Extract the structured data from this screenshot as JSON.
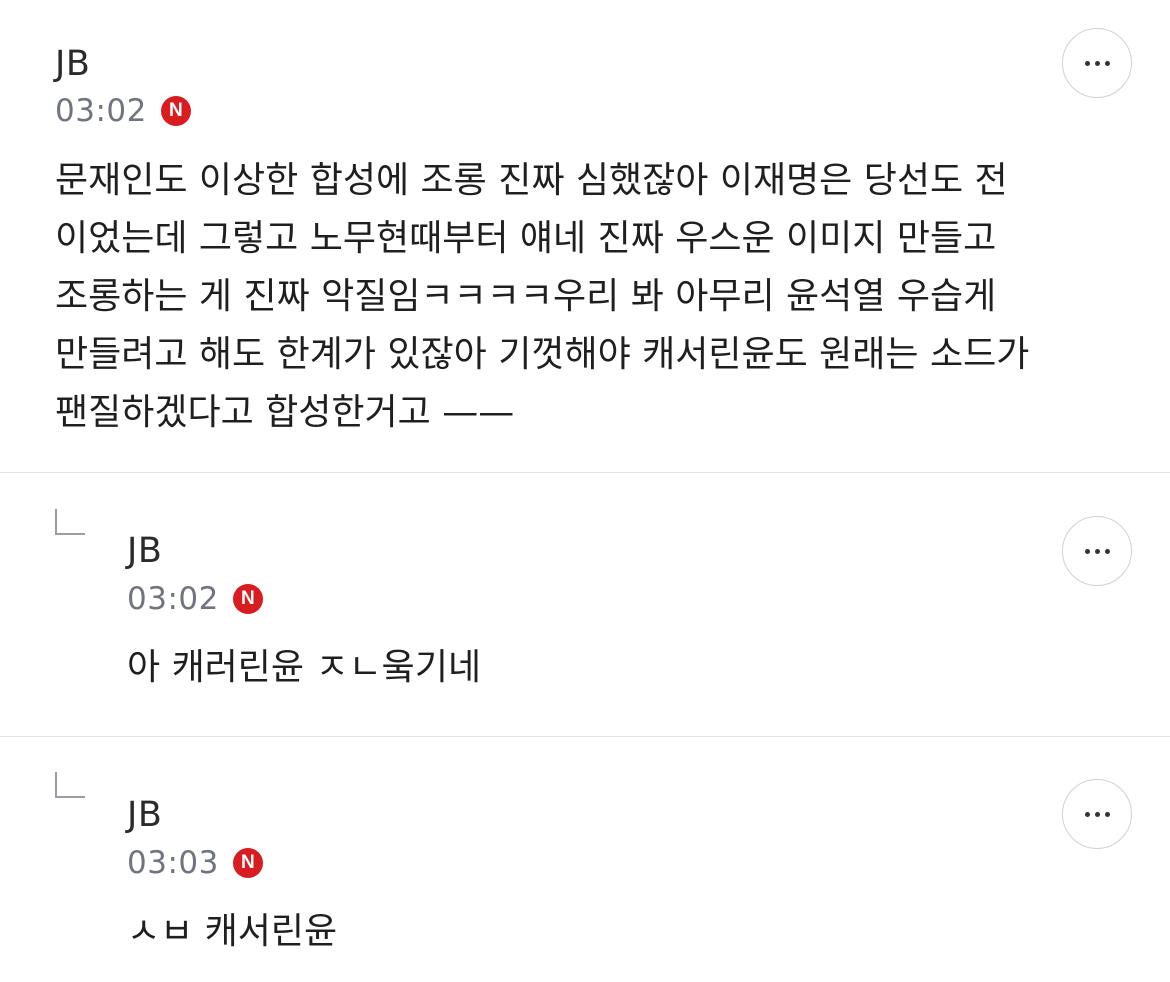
{
  "comments": [
    {
      "author": "JB",
      "time": "03:02",
      "badge": "N",
      "text": "문재인도 이상한 합성에 조롱 진짜 심했잖아 이재명은 당선도 전\n이었는데 그렇고 노무현때부터 얘네 진짜 우스운 이미지 만들고\n조롱하는 게 진짜 악질임ㅋㅋㅋㅋ우리 봐 아무리 윤석열 우습게\n만들려고 해도 한계가 있잖아 기껏해야 캐서린윤도 원래는 소드가\n팬질하겠다고 합성한거고 ——",
      "is_reply": false
    },
    {
      "author": "JB",
      "time": "03:02",
      "badge": "N",
      "text": "아 캐러린윤 ㅈㄴ웈기네",
      "is_reply": true
    },
    {
      "author": "JB",
      "time": "03:03",
      "badge": "N",
      "text": "ㅅㅂ 캐서린윤",
      "is_reply": true
    }
  ],
  "colors": {
    "badge": "#d81c20",
    "time": "#6f7480",
    "divider": "#e2e3e5"
  },
  "icons": {
    "more": "more-horizontal-icon",
    "reply": "reply-arrow-icon",
    "new_badge": "new-badge-icon"
  }
}
